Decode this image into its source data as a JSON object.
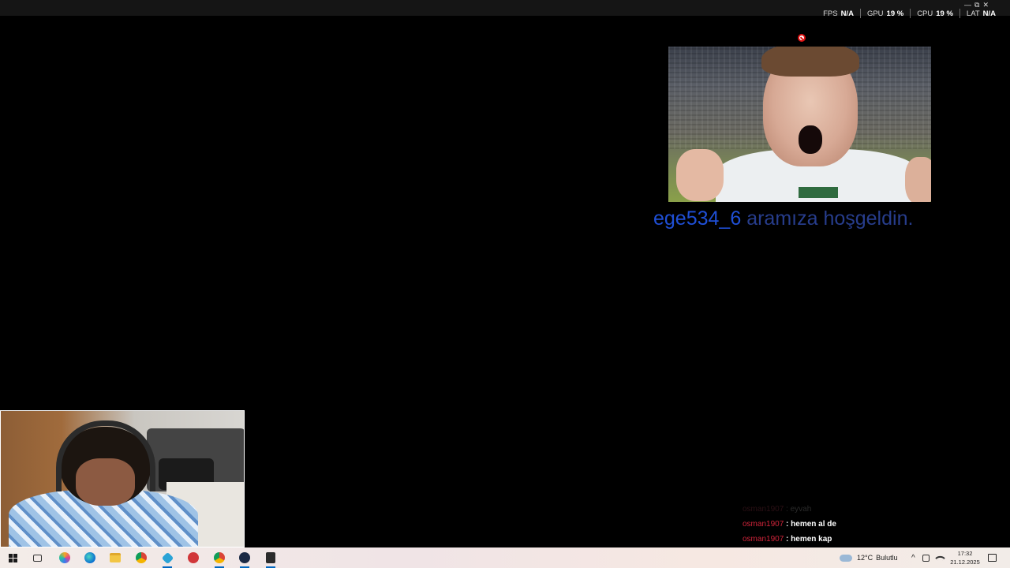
{
  "overlay": {
    "fps_label": "FPS",
    "fps_value": "N/A",
    "gpu_label": "GPU",
    "gpu_value": "19 %",
    "cpu_label": "CPU",
    "cpu_value": "19 %",
    "lat_label": "LAT",
    "lat_value": "N/A"
  },
  "window_controls": {
    "minimize": "—",
    "restore": "⧉",
    "close": "✕"
  },
  "alert": {
    "username": "ege534_6",
    "message": "aramıza hoşgeldin.",
    "user_color": "#1f4fd6",
    "message_color": "#273d8c"
  },
  "chat": {
    "messages": [
      {
        "user": "osman1907",
        "text": "eyvah",
        "faded": true
      },
      {
        "user": "osman1907",
        "text": "hemen al de",
        "faded": false
      },
      {
        "user": "osman1907",
        "text": "hemen kap",
        "faded": false
      }
    ],
    "user_color": "#d0243a"
  },
  "taskbar": {
    "apps": [
      "start-icon",
      "task-view-icon",
      "copilot-icon",
      "edge-icon",
      "file-explorer-icon",
      "chrome-icon",
      "app-icon",
      "riot-icon",
      "chrome-profile-icon",
      "steam-icon",
      "epic-games-icon"
    ],
    "weather_temp": "12°C",
    "weather_desc": "Bulutlu",
    "time": "17:32",
    "date": "21.12.2025"
  }
}
